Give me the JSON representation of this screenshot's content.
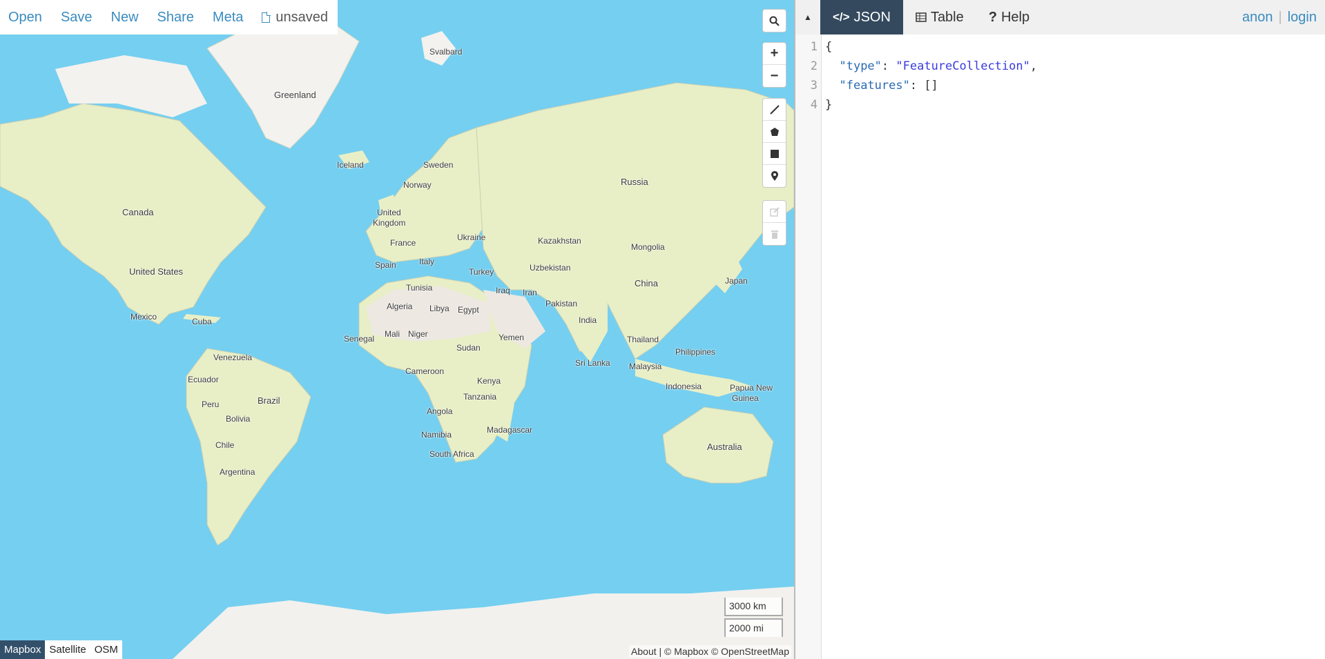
{
  "menu": {
    "items": [
      "Open",
      "Save",
      "New",
      "Share",
      "Meta"
    ],
    "file_status": "unsaved"
  },
  "map": {
    "labels": [
      {
        "text": "Svalbard",
        "cls": "sm"
      },
      {
        "text": "Greenland"
      },
      {
        "text": "Iceland",
        "cls": "sm"
      },
      {
        "text": "Sweden",
        "cls": "sm"
      },
      {
        "text": "Norway",
        "cls": "sm"
      },
      {
        "text": "United",
        "cls": "sm"
      },
      {
        "text": "Kingdom",
        "cls": "sm"
      },
      {
        "text": "France",
        "cls": "sm"
      },
      {
        "text": "Spain",
        "cls": "sm"
      },
      {
        "text": "Italy",
        "cls": "sm"
      },
      {
        "text": "Ukraine",
        "cls": "sm"
      },
      {
        "text": "Turkey",
        "cls": "sm"
      },
      {
        "text": "Kazakhstan",
        "cls": "sm"
      },
      {
        "text": "Uzbekistan",
        "cls": "sm"
      },
      {
        "text": "Mongolia",
        "cls": "sm"
      },
      {
        "text": "Russia"
      },
      {
        "text": "China"
      },
      {
        "text": "Japan",
        "cls": "sm"
      },
      {
        "text": "Iraq",
        "cls": "sm"
      },
      {
        "text": "Iran",
        "cls": "sm"
      },
      {
        "text": "Pakistan",
        "cls": "sm"
      },
      {
        "text": "India",
        "cls": "sm"
      },
      {
        "text": "Thailand",
        "cls": "sm"
      },
      {
        "text": "Philippines",
        "cls": "sm"
      },
      {
        "text": "Malaysia",
        "cls": "sm"
      },
      {
        "text": "Indonesia",
        "cls": "sm"
      },
      {
        "text": "Papua New",
        "cls": "sm"
      },
      {
        "text": "Guinea",
        "cls": "sm"
      },
      {
        "text": "Australia"
      },
      {
        "text": "Sri Lanka",
        "cls": "sm"
      },
      {
        "text": "Canada"
      },
      {
        "text": "United States"
      },
      {
        "text": "Mexico",
        "cls": "sm"
      },
      {
        "text": "Cuba",
        "cls": "sm"
      },
      {
        "text": "Venezuela",
        "cls": "sm"
      },
      {
        "text": "Ecuador",
        "cls": "sm"
      },
      {
        "text": "Peru",
        "cls": "sm"
      },
      {
        "text": "Brazil"
      },
      {
        "text": "Bolivia",
        "cls": "sm"
      },
      {
        "text": "Chile",
        "cls": "sm"
      },
      {
        "text": "Argentina",
        "cls": "sm"
      },
      {
        "text": "Tunisia",
        "cls": "sm"
      },
      {
        "text": "Algeria",
        "cls": "sm"
      },
      {
        "text": "Libya",
        "cls": "sm"
      },
      {
        "text": "Egypt",
        "cls": "sm"
      },
      {
        "text": "Senegal",
        "cls": "sm"
      },
      {
        "text": "Mali",
        "cls": "sm"
      },
      {
        "text": "Niger",
        "cls": "sm"
      },
      {
        "text": "Sudan",
        "cls": "sm"
      },
      {
        "text": "Yemen",
        "cls": "sm"
      },
      {
        "text": "Cameroon",
        "cls": "sm"
      },
      {
        "text": "Kenya",
        "cls": "sm"
      },
      {
        "text": "Tanzania",
        "cls": "sm"
      },
      {
        "text": "Angola",
        "cls": "sm"
      },
      {
        "text": "Namibia",
        "cls": "sm"
      },
      {
        "text": "Madagascar",
        "cls": "sm"
      },
      {
        "text": "South Africa",
        "cls": "sm"
      }
    ],
    "styles": [
      "Mapbox",
      "Satellite",
      "OSM"
    ],
    "active_style": "Mapbox",
    "scale_km": "3000 km",
    "scale_mi": "2000 mi",
    "attribution": "About | © Mapbox © OpenStreetMap"
  },
  "panel": {
    "tabs": [
      {
        "label": "JSON",
        "icon": "code-icon"
      },
      {
        "label": "Table",
        "icon": "table-icon"
      },
      {
        "label": "Help",
        "icon": "question-icon"
      }
    ],
    "active_tab": "JSON",
    "user": "anon",
    "login": "login"
  },
  "editor": {
    "line_numbers": [
      "1",
      "2",
      "3",
      "4"
    ],
    "lines": [
      [
        {
          "t": "{",
          "c": ""
        }
      ],
      [
        {
          "t": "  ",
          "c": ""
        },
        {
          "t": "\"type\"",
          "c": "k"
        },
        {
          "t": ": ",
          "c": ""
        },
        {
          "t": "\"FeatureCollection\"",
          "c": "str"
        },
        {
          "t": ",",
          "c": ""
        }
      ],
      [
        {
          "t": "  ",
          "c": ""
        },
        {
          "t": "\"features\"",
          "c": "k"
        },
        {
          "t": ": []",
          "c": ""
        }
      ],
      [
        {
          "t": "}",
          "c": ""
        }
      ]
    ]
  },
  "colors": {
    "water": "#75cff0",
    "land": "#e8efc6",
    "desert": "#ede8e2",
    "ice": "#f2f1ee",
    "active_tab": "#34495e",
    "link": "#3a8bbf"
  }
}
